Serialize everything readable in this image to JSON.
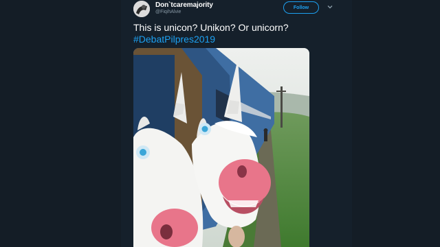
{
  "author": {
    "display_name": "Don`tcaremajority",
    "handle": "@FiqihAlvie"
  },
  "actions": {
    "follow_label": "Follow",
    "menu_icon": "chevron-down-icon"
  },
  "tweet": {
    "text": "This is unicon? Unikon? Or unicorn?",
    "hashtag": "#DebatPilpres2019"
  },
  "media": {
    "subject": "two people in unicorn masks leaning out of a train window",
    "accent_colors": {
      "sky": "#e8ece8",
      "grass": "#4f8a3c",
      "train": "#3f6ea3",
      "mask": "#f2f2f0",
      "nose": "#e8758a"
    }
  },
  "colors": {
    "background": "#141d26",
    "card": "#15202b",
    "accent": "#1da1f2",
    "muted": "#8899a6"
  }
}
